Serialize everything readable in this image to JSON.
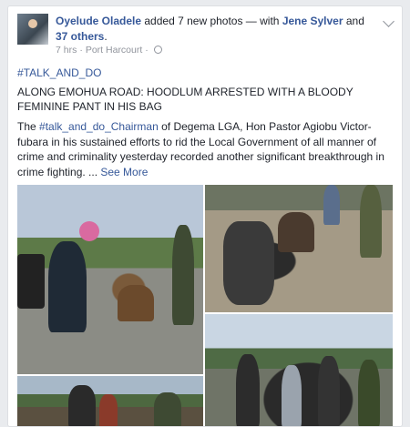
{
  "post": {
    "author": "Oyelude Oladele",
    "action": " added 7 new photos — with ",
    "tagged": "Jene Sylver",
    "and": " and ",
    "others": "37 others",
    "period": ".",
    "time": "7 hrs",
    "location": "Port Harcourt",
    "hashtag": "#TALK_AND_DO",
    "headline": "ALONG EMOHUA ROAD: HOODLUM ARRESTED WITH A BLOODY FEMININE PANT IN HIS BAG",
    "body_prefix": "The ",
    "body_link": "#talk_and_do_Chairman",
    "body_text": " of Degema LGA, Hon Pastor Agiobu Victor-fubara in his sustained efforts to rid the Local Government of all manner of crime and criminality yesterday recorded another significant breakthrough in crime fighting. ... ",
    "see_more": "See More"
  },
  "icons": {
    "globe": "globe-icon",
    "menu": "chevron-down-icon"
  }
}
